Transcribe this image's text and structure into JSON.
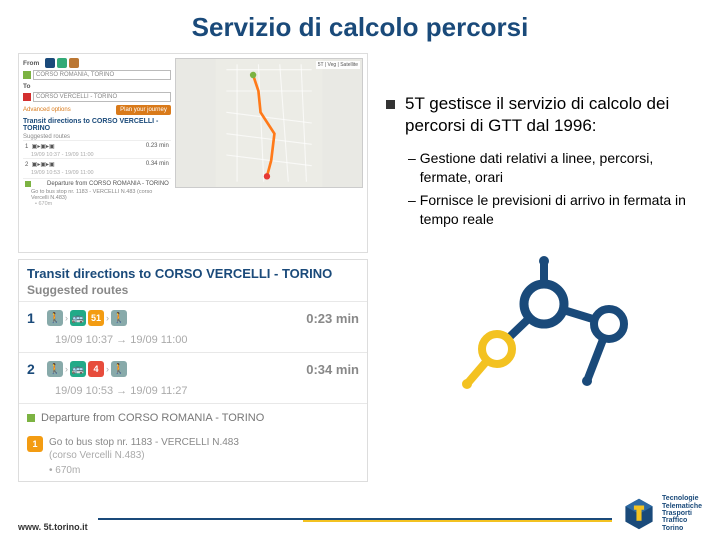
{
  "title": "Servizio di calcolo percorsi",
  "bullet_main": "5T gestisce il servizio di calcolo dei percorsi di GTT dal 1996:",
  "sub1": "Gestione dati relativi a linee, percorsi, fermate, orari",
  "sub2": "Fornisce le previsioni di arrivo in fermata in tempo reale",
  "planner": {
    "from_label": "From",
    "from_value": "CORSO ROMANIA, TORINO",
    "to_label": "To",
    "to_value": "CORSO VERCELLI - TORINO",
    "adv": "Advanced options",
    "plan_btn": "Plan your journey",
    "transit_hdr": "Transit directions to CORSO VERCELLI - TORINO",
    "suggested": "Suggested routes",
    "r1_time": "0.23 min",
    "r1_dates": "19/09 10:37 - 19/09 11:00",
    "r2_time": "0.34 min",
    "r2_dates": "19/09 10:53 - 19/09 11:00",
    "depart": "Departure from CORSO ROMANIA - TORINO",
    "step1": "Go to bus stop nr. 1183 - VERCELLI N.483 (corso Vercelli N.483)",
    "step1b": "670m"
  },
  "zoom": {
    "title": "Transit directions to CORSO VERCELLI - TORINO",
    "suggested": "Suggested routes",
    "r1_badge": "51",
    "r1_dur": "0:23 min",
    "r1_times": "19/09 10:37 → 19/09 11:00",
    "r2_badge": "4",
    "r2_dur": "0:34 min",
    "r2_times": "19/09 10:53 → 19/09 11:27",
    "depart": "Departure from CORSO ROMANIA - TORINO",
    "step_num": "1",
    "step_text": "Go to bus stop nr. 1183 - VERCELLI N.483",
    "step_sub": "(corso Vercelli N.483)",
    "step_dist": "670m"
  },
  "footer": {
    "url": "www. 5t.torino.it",
    "brand": "Tecnologie\nTelematiche\nTrasporti\nTraffico\nTorino"
  }
}
